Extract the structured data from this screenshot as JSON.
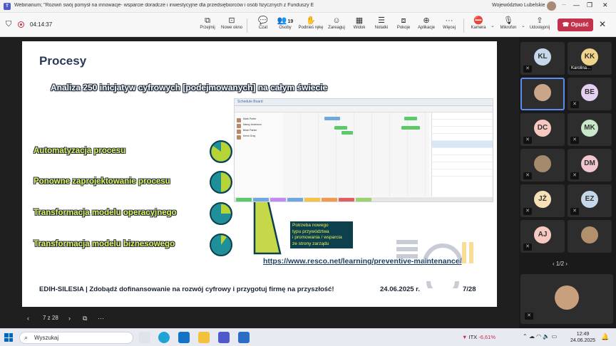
{
  "window": {
    "title": "Webinarium; \"Rozwiń swój pomysł na innowacje- wsparcie doradcze i inwestycyjne dla przedsiębiorców i osób fizycznych z Funduszy Euro...",
    "org": "Województwo Lubelskie",
    "more": "...",
    "minimize": "—",
    "maximize": "❐",
    "close": "✕"
  },
  "toolbar": {
    "timer": "04:14:37",
    "buttons": [
      {
        "icon": "share-screen-icon",
        "label": "Przejmij"
      },
      {
        "icon": "new-window-icon",
        "label": "Nowe okno"
      },
      {
        "icon": "chat-icon",
        "label": "Czat"
      },
      {
        "icon": "people-icon",
        "label": "Osoby",
        "count": "19"
      },
      {
        "icon": "raise-hand-icon",
        "label": "Podnieś rękę"
      },
      {
        "icon": "react-icon",
        "label": "Zareaguj"
      },
      {
        "icon": "view-icon",
        "label": "Widok"
      },
      {
        "icon": "notes-icon",
        "label": "Notatki"
      },
      {
        "icon": "rooms-icon",
        "label": "Pokoje"
      },
      {
        "icon": "apps-icon",
        "label": "Aplikacje"
      },
      {
        "icon": "more-icon",
        "label": "Więcej"
      },
      {
        "icon": "camera-off-icon",
        "label": "Kamera"
      },
      {
        "icon": "mic-off-icon",
        "label": "Mikrofon"
      },
      {
        "icon": "share-icon",
        "label": "Udostępnij"
      }
    ],
    "leave_label": "Opuść"
  },
  "slide": {
    "title": "Procesy",
    "subtitle": "Analiza 250 inicjatyw cyfrowych [podejmowanych] na całym świecie",
    "levels": [
      {
        "label": "Automatyzacja procesu",
        "fraction": 0.85
      },
      {
        "label": "Ponowne zaprojektowanie procesu",
        "fraction": 0.5
      },
      {
        "label": "Transformacja modelu operacyjnego",
        "fraction": 0.25
      },
      {
        "label": "Transformacja modelu biznesowego",
        "fraction": 0.1
      }
    ],
    "need_box": [
      "Potrzeba nowego",
      "typu przywództwa",
      "i promowania / wsparcia",
      "ze strony zarządu"
    ],
    "url": "https://www.resco.net/learning/preventive-maintenance/",
    "footer": "EDIH-SILESIA | Zdobądź dofinansowanie na rozwój cyfrowy i przygotuj firmę na przyszłość!",
    "date": "24.06.2025 r.",
    "page": "7/28",
    "colors": {
      "accent": "#e8f25a",
      "dark": "#0e3f4d",
      "pie_fill": "#b7d334",
      "pie_bg": "#1f8f9a"
    }
  },
  "screenshot": {
    "header": "Schedule Board",
    "col_a": "Jun 23 2022",
    "col_b": "Jun 24 2022",
    "resources": [
      "Mark Porter",
      "Nancy Anderson",
      "Brian Parker",
      "Kevin Gray"
    ]
  },
  "presenter_controls": {
    "page": "7 z 28",
    "prev": "‹",
    "next": "›",
    "more": "···"
  },
  "gallery": {
    "participants": [
      {
        "initials": "KL",
        "color": "#c7d7ea"
      },
      {
        "initials": "KK",
        "color": "#f1d38d",
        "name": "Karolina..."
      },
      {
        "initials": "",
        "photo": true
      },
      {
        "initials": "BE",
        "color": "#e4d0f0"
      },
      {
        "initials": "DC",
        "color": "#f6c9c0"
      },
      {
        "initials": "MK",
        "color": "#c9e8c9"
      },
      {
        "initials": "",
        "photo": true
      },
      {
        "initials": "DM",
        "color": "#f2c6cf"
      },
      {
        "initials": "JŻ",
        "color": "#f5e0b8"
      },
      {
        "initials": "EZ",
        "color": "#c7d7ea"
      },
      {
        "initials": "AJ",
        "color": "#f6c9c0"
      },
      {
        "initials": "",
        "photo": true
      }
    ],
    "pager": "1/2"
  },
  "taskbar": {
    "search_placeholder": "Wyszukaj",
    "stock_symbol": "ITX",
    "stock_change": "-6,61%",
    "time": "12:49",
    "date": "24.06.2025"
  }
}
